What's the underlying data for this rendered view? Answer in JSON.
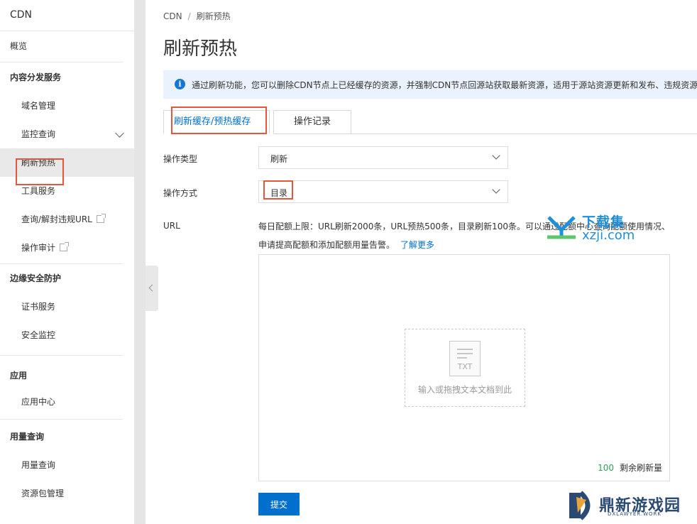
{
  "sidebar": {
    "title": "CDN",
    "overview": "概览",
    "groups": [
      {
        "label": "内容分发服务",
        "items": [
          "域名管理",
          "监控查询",
          "刷新预热",
          "工具服务",
          "查询/解封违规URL",
          "操作审计"
        ]
      },
      {
        "label": "边缘安全防护",
        "items": [
          "证书服务",
          "安全监控"
        ]
      },
      {
        "label": "应用",
        "items": [
          "应用中心"
        ]
      },
      {
        "label": "用量查询",
        "items": [
          "用量查询",
          "资源包管理"
        ]
      }
    ]
  },
  "breadcrumb": {
    "root": "CDN",
    "separator": "/",
    "current": "刷新预热"
  },
  "page_title": "刷新预热",
  "info": {
    "icon": "info-icon",
    "text": "通过刷新功能，您可以删除CDN节点上已经缓存的资源，并强制CDN节点回源站获取最新资源，适用于源站资源更新和发布、违规资源清"
  },
  "tabs": [
    "刷新缓存/预热缓存",
    "操作记录"
  ],
  "form": {
    "op_type_label": "操作类型",
    "op_type_value": "刷新",
    "op_mode_label": "操作方式",
    "op_mode_value": "目录",
    "url_label": "URL",
    "url_desc": "每日配额上限：URL刷新2000条，URL预热500条，目录刷新100条。可以通过配额中心查询配额使用情况、申请提高配额和添加配额用量告警。",
    "learn_more": "了解更多",
    "doc_icon_text": "TXT",
    "drop_text": "输入或拖拽文本文档到此",
    "remaining_count": "100",
    "remaining_label": "剩余刷新量",
    "submit": "提交"
  },
  "watermarks": {
    "xzji_top": "下载集",
    "xzji_bottom": "xzji.com",
    "dx_title": "鼎新游戏园",
    "dx_sub": "DXLAWYER.WORK"
  },
  "colors": {
    "accent": "#0070cc",
    "highlight": "#e4573a",
    "info_bg": "#eaf3fd",
    "count_green": "#2fa05a"
  }
}
